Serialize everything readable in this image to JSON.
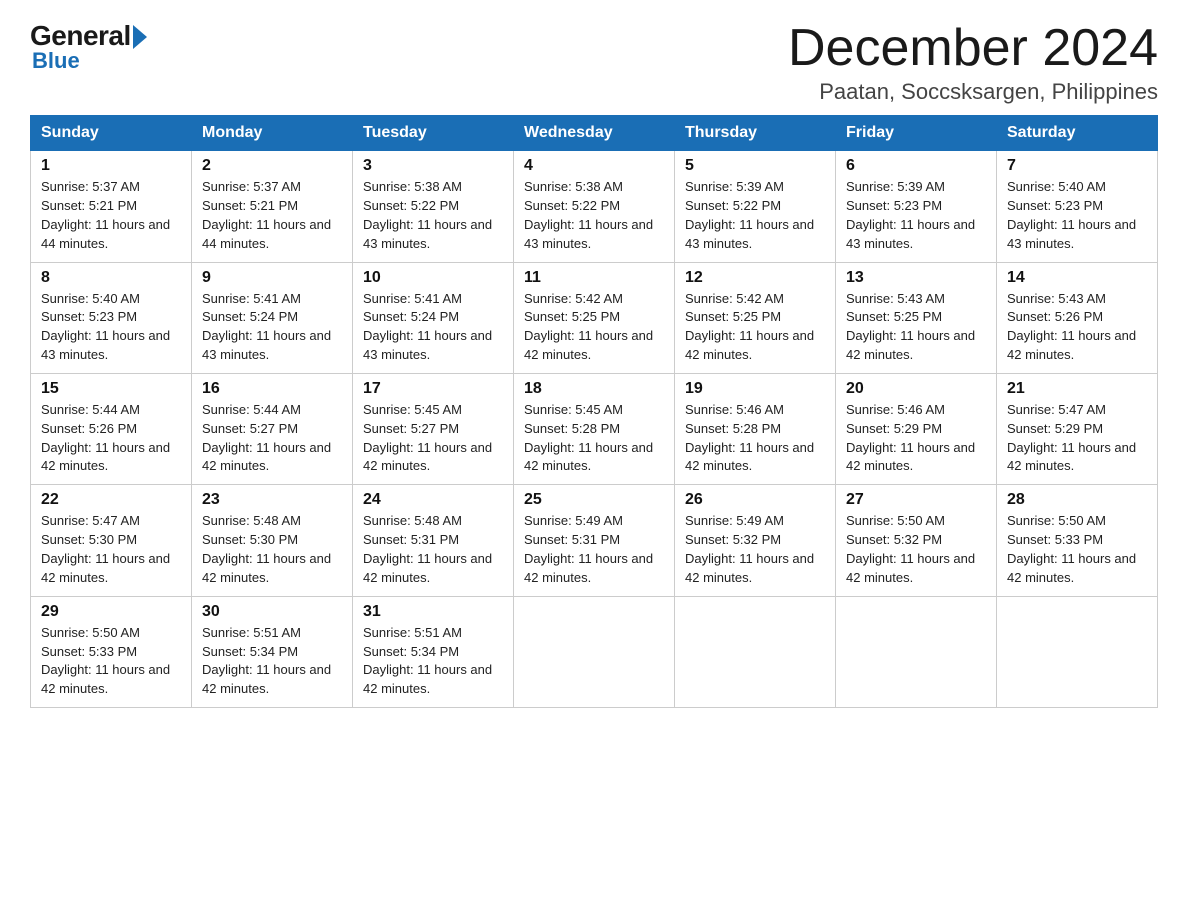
{
  "header": {
    "logo": {
      "general": "General",
      "blue": "Blue"
    },
    "month": "December 2024",
    "location": "Paatan, Soccsksargen, Philippines"
  },
  "days_of_week": [
    "Sunday",
    "Monday",
    "Tuesday",
    "Wednesday",
    "Thursday",
    "Friday",
    "Saturday"
  ],
  "weeks": [
    [
      {
        "day": "1",
        "sunrise": "5:37 AM",
        "sunset": "5:21 PM",
        "daylight": "11 hours and 44 minutes."
      },
      {
        "day": "2",
        "sunrise": "5:37 AM",
        "sunset": "5:21 PM",
        "daylight": "11 hours and 44 minutes."
      },
      {
        "day": "3",
        "sunrise": "5:38 AM",
        "sunset": "5:22 PM",
        "daylight": "11 hours and 43 minutes."
      },
      {
        "day": "4",
        "sunrise": "5:38 AM",
        "sunset": "5:22 PM",
        "daylight": "11 hours and 43 minutes."
      },
      {
        "day": "5",
        "sunrise": "5:39 AM",
        "sunset": "5:22 PM",
        "daylight": "11 hours and 43 minutes."
      },
      {
        "day": "6",
        "sunrise": "5:39 AM",
        "sunset": "5:23 PM",
        "daylight": "11 hours and 43 minutes."
      },
      {
        "day": "7",
        "sunrise": "5:40 AM",
        "sunset": "5:23 PM",
        "daylight": "11 hours and 43 minutes."
      }
    ],
    [
      {
        "day": "8",
        "sunrise": "5:40 AM",
        "sunset": "5:23 PM",
        "daylight": "11 hours and 43 minutes."
      },
      {
        "day": "9",
        "sunrise": "5:41 AM",
        "sunset": "5:24 PM",
        "daylight": "11 hours and 43 minutes."
      },
      {
        "day": "10",
        "sunrise": "5:41 AM",
        "sunset": "5:24 PM",
        "daylight": "11 hours and 43 minutes."
      },
      {
        "day": "11",
        "sunrise": "5:42 AM",
        "sunset": "5:25 PM",
        "daylight": "11 hours and 42 minutes."
      },
      {
        "day": "12",
        "sunrise": "5:42 AM",
        "sunset": "5:25 PM",
        "daylight": "11 hours and 42 minutes."
      },
      {
        "day": "13",
        "sunrise": "5:43 AM",
        "sunset": "5:25 PM",
        "daylight": "11 hours and 42 minutes."
      },
      {
        "day": "14",
        "sunrise": "5:43 AM",
        "sunset": "5:26 PM",
        "daylight": "11 hours and 42 minutes."
      }
    ],
    [
      {
        "day": "15",
        "sunrise": "5:44 AM",
        "sunset": "5:26 PM",
        "daylight": "11 hours and 42 minutes."
      },
      {
        "day": "16",
        "sunrise": "5:44 AM",
        "sunset": "5:27 PM",
        "daylight": "11 hours and 42 minutes."
      },
      {
        "day": "17",
        "sunrise": "5:45 AM",
        "sunset": "5:27 PM",
        "daylight": "11 hours and 42 minutes."
      },
      {
        "day": "18",
        "sunrise": "5:45 AM",
        "sunset": "5:28 PM",
        "daylight": "11 hours and 42 minutes."
      },
      {
        "day": "19",
        "sunrise": "5:46 AM",
        "sunset": "5:28 PM",
        "daylight": "11 hours and 42 minutes."
      },
      {
        "day": "20",
        "sunrise": "5:46 AM",
        "sunset": "5:29 PM",
        "daylight": "11 hours and 42 minutes."
      },
      {
        "day": "21",
        "sunrise": "5:47 AM",
        "sunset": "5:29 PM",
        "daylight": "11 hours and 42 minutes."
      }
    ],
    [
      {
        "day": "22",
        "sunrise": "5:47 AM",
        "sunset": "5:30 PM",
        "daylight": "11 hours and 42 minutes."
      },
      {
        "day": "23",
        "sunrise": "5:48 AM",
        "sunset": "5:30 PM",
        "daylight": "11 hours and 42 minutes."
      },
      {
        "day": "24",
        "sunrise": "5:48 AM",
        "sunset": "5:31 PM",
        "daylight": "11 hours and 42 minutes."
      },
      {
        "day": "25",
        "sunrise": "5:49 AM",
        "sunset": "5:31 PM",
        "daylight": "11 hours and 42 minutes."
      },
      {
        "day": "26",
        "sunrise": "5:49 AM",
        "sunset": "5:32 PM",
        "daylight": "11 hours and 42 minutes."
      },
      {
        "day": "27",
        "sunrise": "5:50 AM",
        "sunset": "5:32 PM",
        "daylight": "11 hours and 42 minutes."
      },
      {
        "day": "28",
        "sunrise": "5:50 AM",
        "sunset": "5:33 PM",
        "daylight": "11 hours and 42 minutes."
      }
    ],
    [
      {
        "day": "29",
        "sunrise": "5:50 AM",
        "sunset": "5:33 PM",
        "daylight": "11 hours and 42 minutes."
      },
      {
        "day": "30",
        "sunrise": "5:51 AM",
        "sunset": "5:34 PM",
        "daylight": "11 hours and 42 minutes."
      },
      {
        "day": "31",
        "sunrise": "5:51 AM",
        "sunset": "5:34 PM",
        "daylight": "11 hours and 42 minutes."
      },
      null,
      null,
      null,
      null
    ]
  ]
}
